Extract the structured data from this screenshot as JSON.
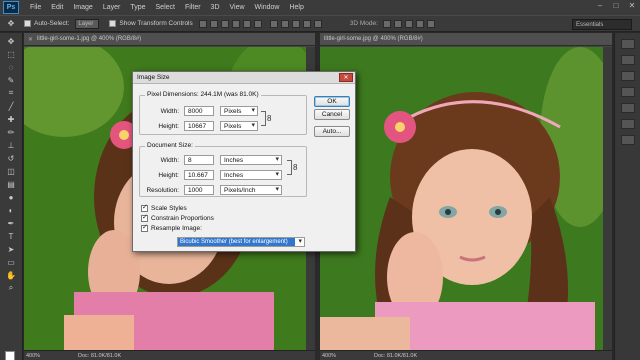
{
  "menu": {
    "logo": "Ps",
    "items": [
      "File",
      "Edit",
      "Image",
      "Layer",
      "Type",
      "Select",
      "Filter",
      "3D",
      "View",
      "Window",
      "Help"
    ]
  },
  "options": {
    "auto_select_label": "Auto-Select:",
    "auto_select_value": "Layer",
    "show_transform": "Show Transform Controls",
    "mode3d": "3D Mode:",
    "workspace": "Essentials"
  },
  "left_doc": {
    "tab": "little-girl-some-1.jpg @ 400% (RGB/8#)",
    "zoom": "400%",
    "docinfo": "Doc: 81.0K/81.0K"
  },
  "right_doc": {
    "tab": "little-girl-some.jpg @ 400% (RGB/8#)",
    "zoom": "400%",
    "docinfo": "Doc: 81.0K/81.0K"
  },
  "dialog": {
    "title": "Image Size",
    "pixel_dims_label": "Pixel Dimensions:",
    "pixel_dims_value": "244.1M (was 81.0K)",
    "width_label": "Width:",
    "width_px": "8000",
    "height_label": "Height:",
    "height_px": "10667",
    "px_unit": "Pixels",
    "doc_size_label": "Document Size:",
    "doc_width": "8",
    "doc_height": "10.667",
    "in_unit": "Inches",
    "resolution_label": "Resolution:",
    "resolution": "1000",
    "res_unit": "Pixels/Inch",
    "scale_styles": "Scale Styles",
    "constrain": "Constrain Proportions",
    "resample": "Resample Image:",
    "resample_value": "Bicubic Smoother (best for enlargement)",
    "ok": "OK",
    "cancel": "Cancel",
    "auto": "Auto..."
  }
}
